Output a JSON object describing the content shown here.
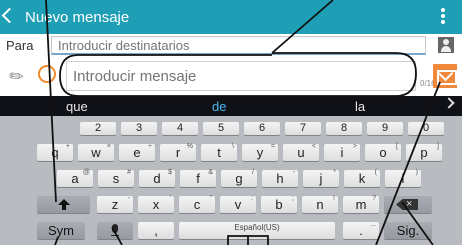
{
  "action_bar": {
    "title": "Nuevo mensaje"
  },
  "recipient": {
    "label": "Para",
    "placeholder": "Introducir destinatarios"
  },
  "compose": {
    "placeholder": "Introducir mensaje",
    "counter": "0/160/1"
  },
  "predictions": [
    "que",
    "de",
    "la"
  ],
  "keyboard": {
    "number_row": [
      "2",
      "3",
      "4",
      "5",
      "6",
      "7",
      "8",
      "9",
      "0"
    ],
    "row1": [
      {
        "k": "q",
        "h": "+"
      },
      {
        "k": "w",
        "h": "×"
      },
      {
        "k": "e",
        "h": "÷"
      },
      {
        "k": "r",
        "h": "%"
      },
      {
        "k": "t",
        "h": "\\"
      },
      {
        "k": "y",
        "h": "="
      },
      {
        "k": "u",
        "h": "<"
      },
      {
        "k": "i",
        "h": ">"
      },
      {
        "k": "o",
        "h": "["
      },
      {
        "k": "p",
        "h": "]"
      }
    ],
    "row2": [
      {
        "k": "a",
        "h": "@"
      },
      {
        "k": "s",
        "h": "#"
      },
      {
        "k": "d",
        "h": "$"
      },
      {
        "k": "f",
        "h": "&"
      },
      {
        "k": "g",
        "h": "/"
      },
      {
        "k": "h",
        "h": "-"
      },
      {
        "k": "j",
        "h": "*"
      },
      {
        "k": "k",
        "h": "("
      },
      {
        "k": "l",
        "h": ")"
      }
    ],
    "row3": [
      {
        "k": "z",
        "h": "-"
      },
      {
        "k": "x",
        "h": "'"
      },
      {
        "k": "c",
        "h": "\""
      },
      {
        "k": "v",
        "h": ":"
      },
      {
        "k": "b",
        "h": ";"
      },
      {
        "k": "n",
        "h": "!"
      },
      {
        "k": "m",
        "h": "?"
      }
    ],
    "sym_label": "Sym",
    "comma": ",",
    "space_label": "Español(US)",
    "period": ".",
    "period_hint": "...",
    "next_label": "Sig."
  },
  "icons": {
    "back": "chevron-left-icon",
    "overflow": "three-dots-vertical-icon",
    "contacts": "contact-icon",
    "attach": "paperclip-icon",
    "emoji": "smiley-icon",
    "send": "envelope-icon",
    "shift": "shift-arrow-icon",
    "backspace": "backspace-icon",
    "mic": "microphone-icon"
  },
  "colors": {
    "action_bar": "#1f9fb5",
    "send_button": "#f0893a",
    "prediction_highlight": "#4ab8f0"
  }
}
